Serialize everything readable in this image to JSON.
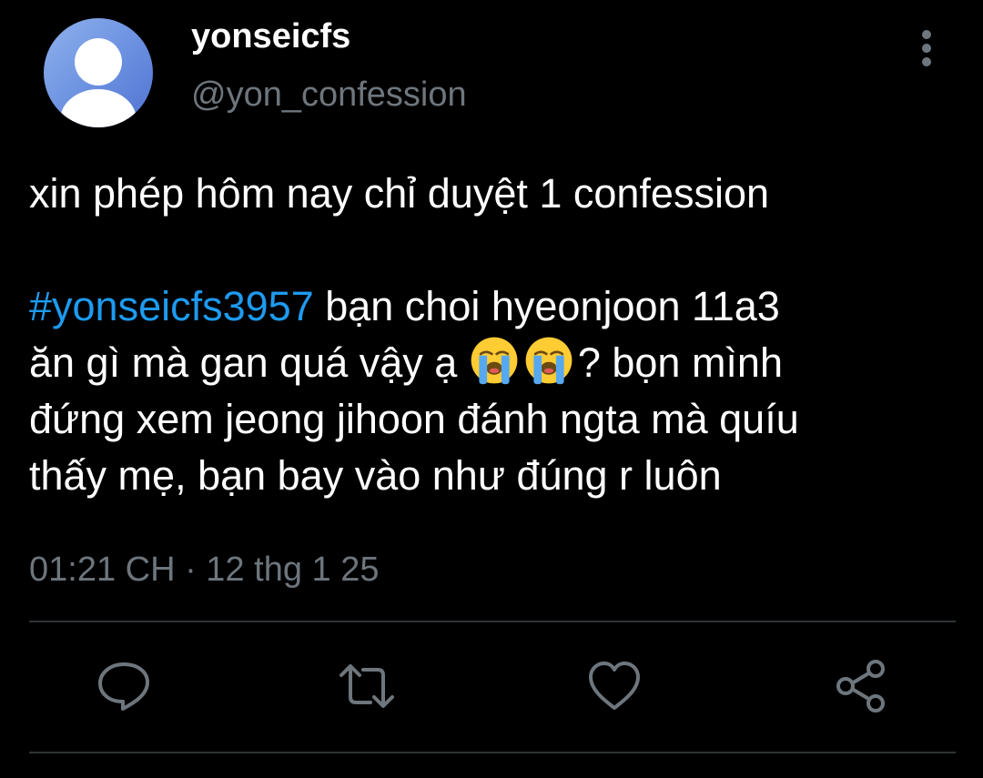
{
  "author": {
    "display_name": "yonseicfs",
    "handle": "@yon_confession"
  },
  "tweet": {
    "line1": "xin phép hôm nay chỉ duyệt 1 confession",
    "hashtag": "#yonseicfs3957",
    "line2_rest": " bạn choi hyeonjoon 11a3",
    "line3_start": "ăn gì mà gan quá vậy ạ ",
    "emoji": [
      "loudly-crying-face-emoji",
      "loudly-crying-face-emoji"
    ],
    "line3_end": "? bọn mình",
    "line4": "đứng xem jeong jihoon đánh ngta mà quíu",
    "line5": "thấy mẹ, bạn bay vào như đúng r luôn"
  },
  "timestamp": "01:21 CH · 12 thg 1 25",
  "actions": [
    "reply-icon",
    "retweet-icon",
    "like-icon",
    "share-icon"
  ],
  "colors": {
    "background": "#000000",
    "text": "#ffffff",
    "secondary": "#6e767d",
    "hashtag": "#1d9bf0",
    "divider": "#2f3336"
  }
}
